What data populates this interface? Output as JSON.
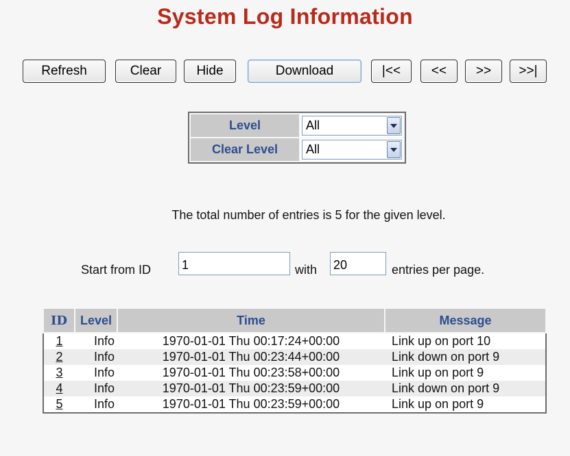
{
  "page": {
    "title": "System Log Information"
  },
  "toolbar": {
    "refresh": "Refresh",
    "clear": "Clear",
    "hide": "Hide",
    "download": "Download",
    "first": "|<<",
    "prev": "<<",
    "next": ">>",
    "last": ">>|"
  },
  "filters": {
    "level_label": "Level",
    "level_value": "All",
    "clear_level_label": "Clear Level",
    "clear_level_value": "All"
  },
  "summary": {
    "total_text": "The total number of entries is 5 for the given level."
  },
  "paging": {
    "start_label": "Start from ID",
    "start_value": "1",
    "with_label": "with",
    "entries_value": "20",
    "entries_label": "entries per page."
  },
  "log": {
    "columns": {
      "id": "ID",
      "level": "Level",
      "time": "Time",
      "message": "Message"
    },
    "rows": [
      {
        "id": "1",
        "level": "Info",
        "time": "1970-01-01 Thu 00:17:24+00:00",
        "message": "Link up on port 10"
      },
      {
        "id": "2",
        "level": "Info",
        "time": "1970-01-01 Thu 00:23:44+00:00",
        "message": "Link down on port 9"
      },
      {
        "id": "3",
        "level": "Info",
        "time": "1970-01-01 Thu 00:23:58+00:00",
        "message": "Link up on port 9"
      },
      {
        "id": "4",
        "level": "Info",
        "time": "1970-01-01 Thu 00:23:59+00:00",
        "message": "Link down on port 9"
      },
      {
        "id": "5",
        "level": "Info",
        "time": "1970-01-01 Thu 00:23:59+00:00",
        "message": "Link up on port 9"
      }
    ]
  },
  "colors": {
    "title": "#b82a1a",
    "header_text": "#2c4d8f",
    "header_bg": "#c9c9c9",
    "page_bg": "#f6f6f6"
  },
  "icons": {
    "select_arrow": "chevron-down-icon"
  }
}
